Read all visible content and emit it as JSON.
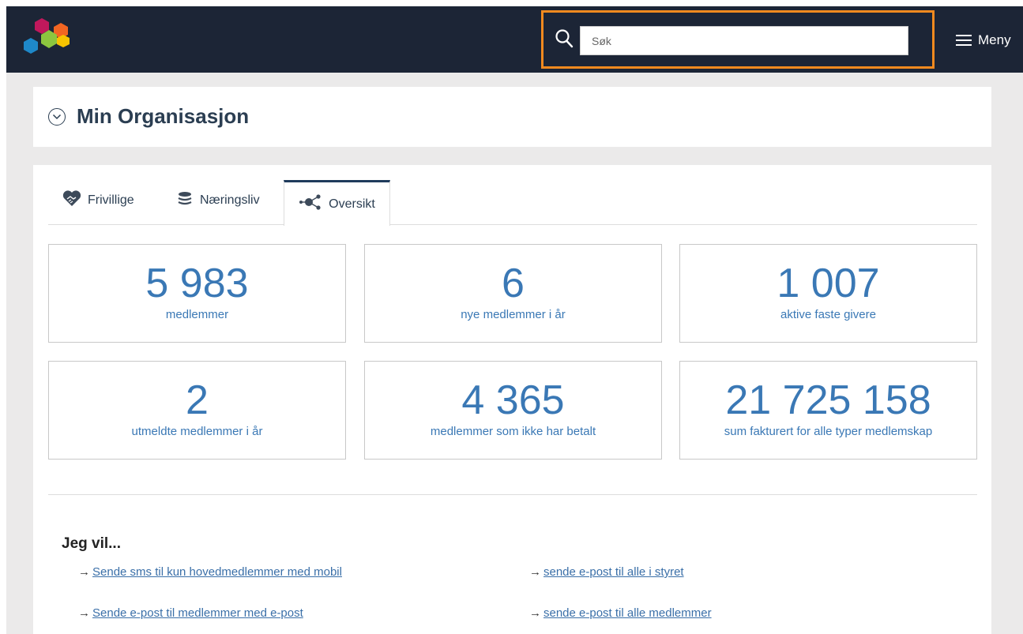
{
  "header": {
    "search_placeholder": "Søk",
    "menu_label": "Meny",
    "accent_color": "#f28a1f",
    "background_color": "#1c2536"
  },
  "page": {
    "title": "Min Organisasjon"
  },
  "tabs": [
    {
      "label": "Frivillige",
      "icon": "handshake-icon",
      "active": false
    },
    {
      "label": "Næringsliv",
      "icon": "coin-stack-icon",
      "active": false
    },
    {
      "label": "Oversikt",
      "icon": "network-icon",
      "active": true
    }
  ],
  "stats": [
    {
      "value": "5 983",
      "label": "medlemmer"
    },
    {
      "value": "6",
      "label": "nye medlemmer i år"
    },
    {
      "value": "1 007",
      "label": "aktive faste givere"
    },
    {
      "value": "2",
      "label": "utmeldte medlemmer i år"
    },
    {
      "value": "4 365",
      "label": "medlemmer som ikke har betalt"
    },
    {
      "value": "21 725 158",
      "label": "sum fakturert for alle typer medlemskap"
    }
  ],
  "actions": {
    "heading": "Jeg vil...",
    "arrow": "→",
    "links": [
      {
        "label": "Sende sms til kun hovedmedlemmer med mobil"
      },
      {
        "label": "sende e-post til alle i styret"
      },
      {
        "label": "Sende e-post til medlemmer med e-post"
      },
      {
        "label": "sende e-post til alle medlemmer"
      }
    ]
  }
}
